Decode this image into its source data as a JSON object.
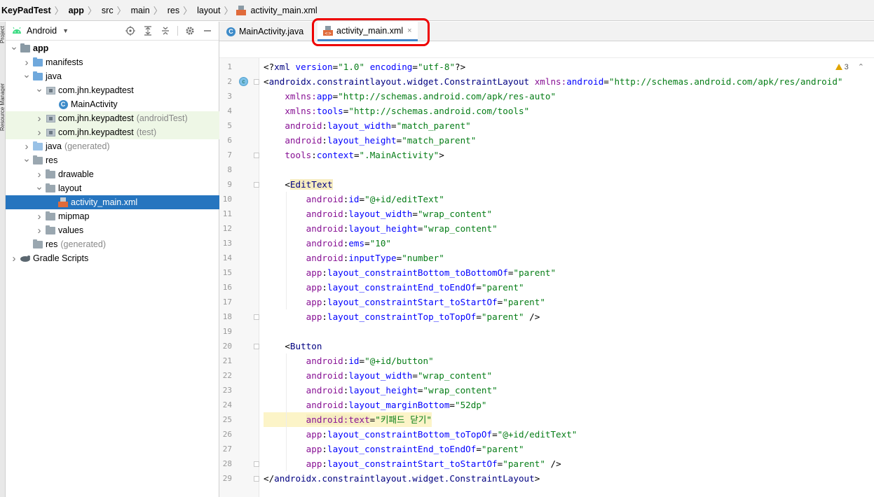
{
  "breadcrumb": [
    "KeyPadTest",
    "app",
    "src",
    "main",
    "res",
    "layout",
    "activity_main.xml"
  ],
  "side_tabs": [
    "Project",
    "Resource Manager"
  ],
  "project_panel": {
    "view_mode": "Android",
    "tool_icons": [
      "target-icon",
      "expand-all-icon",
      "collapse-all-icon",
      "gear-icon",
      "minimize-icon"
    ]
  },
  "tree": [
    {
      "label": "app",
      "hint": "",
      "depth": 0,
      "expanded": true,
      "icon": "module",
      "bold": true
    },
    {
      "label": "manifests",
      "hint": "",
      "depth": 1,
      "expanded": false,
      "icon": "folder-blue"
    },
    {
      "label": "java",
      "hint": "",
      "depth": 1,
      "expanded": true,
      "icon": "folder-blue"
    },
    {
      "label": "com.jhn.keypadtest",
      "hint": "",
      "depth": 2,
      "expanded": true,
      "icon": "package"
    },
    {
      "label": "MainActivity",
      "hint": "",
      "depth": 3,
      "expanded": null,
      "icon": "class"
    },
    {
      "label": "com.jhn.keypadtest",
      "hint": "(androidTest)",
      "depth": 2,
      "expanded": false,
      "icon": "package",
      "test": true
    },
    {
      "label": "com.jhn.keypadtest",
      "hint": "(test)",
      "depth": 2,
      "expanded": false,
      "icon": "package",
      "test": true
    },
    {
      "label": "java",
      "hint": "(generated)",
      "depth": 1,
      "expanded": false,
      "icon": "folder-gen"
    },
    {
      "label": "res",
      "hint": "",
      "depth": 1,
      "expanded": true,
      "icon": "folder"
    },
    {
      "label": "drawable",
      "hint": "",
      "depth": 2,
      "expanded": false,
      "icon": "folder"
    },
    {
      "label": "layout",
      "hint": "",
      "depth": 2,
      "expanded": true,
      "icon": "folder"
    },
    {
      "label": "activity_main.xml",
      "hint": "",
      "depth": 3,
      "expanded": null,
      "icon": "xml",
      "selected": true
    },
    {
      "label": "mipmap",
      "hint": "",
      "depth": 2,
      "expanded": false,
      "icon": "folder"
    },
    {
      "label": "values",
      "hint": "",
      "depth": 2,
      "expanded": false,
      "icon": "folder"
    },
    {
      "label": "res",
      "hint": "(generated)",
      "depth": 1,
      "expanded": null,
      "icon": "folder"
    },
    {
      "label": "Gradle Scripts",
      "hint": "",
      "depth": 0,
      "expanded": false,
      "icon": "gradle"
    }
  ],
  "tabs": [
    {
      "label": "MainActivity.java",
      "icon": "class",
      "active": false
    },
    {
      "label": "activity_main.xml",
      "icon": "xml",
      "active": true,
      "close": "×"
    }
  ],
  "editor": {
    "warnings": "3",
    "lines": [
      [
        [
          "pun",
          "<?"
        ],
        [
          "tag",
          "xml "
        ],
        [
          "at",
          "version"
        ],
        [
          "pun",
          "="
        ],
        [
          "str",
          "\"1.0\""
        ],
        [
          "pun",
          " "
        ],
        [
          "at",
          "encoding"
        ],
        [
          "pun",
          "="
        ],
        [
          "str",
          "\"utf-8\""
        ],
        [
          "pun",
          "?>"
        ]
      ],
      [
        [
          "pun",
          "<"
        ],
        [
          "tag",
          "androidx.constraintlayout.widget.ConstraintLayout"
        ],
        [
          "pun",
          " "
        ],
        [
          "ns",
          "xmlns:"
        ],
        [
          "at",
          "android"
        ],
        [
          "pun",
          "="
        ],
        [
          "str",
          "\"http://schemas.android.com/apk/res/android\""
        ]
      ],
      [
        [
          "pun",
          "    "
        ],
        [
          "ns",
          "xmlns:"
        ],
        [
          "at",
          "app"
        ],
        [
          "pun",
          "="
        ],
        [
          "str",
          "\"http://schemas.android.com/apk/res-auto\""
        ]
      ],
      [
        [
          "pun",
          "    "
        ],
        [
          "ns",
          "xmlns:"
        ],
        [
          "at",
          "tools"
        ],
        [
          "pun",
          "="
        ],
        [
          "str",
          "\"http://schemas.android.com/tools\""
        ]
      ],
      [
        [
          "pun",
          "    "
        ],
        [
          "ns",
          "android"
        ],
        [
          "pun",
          ":"
        ],
        [
          "at",
          "layout_width"
        ],
        [
          "pun",
          "="
        ],
        [
          "str",
          "\"match_parent\""
        ]
      ],
      [
        [
          "pun",
          "    "
        ],
        [
          "ns",
          "android"
        ],
        [
          "pun",
          ":"
        ],
        [
          "at",
          "layout_height"
        ],
        [
          "pun",
          "="
        ],
        [
          "str",
          "\"match_parent\""
        ]
      ],
      [
        [
          "pun",
          "    "
        ],
        [
          "ns",
          "tools"
        ],
        [
          "pun",
          ":"
        ],
        [
          "at",
          "context"
        ],
        [
          "pun",
          "="
        ],
        [
          "str",
          "\".MainActivity\""
        ],
        [
          "pun",
          ">"
        ]
      ],
      [],
      [
        [
          "pun",
          "    <"
        ],
        [
          "tagbg",
          "EditText"
        ]
      ],
      [
        [
          "pun",
          "        "
        ],
        [
          "ns",
          "android"
        ],
        [
          "pun",
          ":"
        ],
        [
          "at",
          "id"
        ],
        [
          "pun",
          "="
        ],
        [
          "str",
          "\"@+id/editText\""
        ]
      ],
      [
        [
          "pun",
          "        "
        ],
        [
          "ns",
          "android"
        ],
        [
          "pun",
          ":"
        ],
        [
          "at",
          "layout_width"
        ],
        [
          "pun",
          "="
        ],
        [
          "str",
          "\"wrap_content\""
        ]
      ],
      [
        [
          "pun",
          "        "
        ],
        [
          "ns",
          "android"
        ],
        [
          "pun",
          ":"
        ],
        [
          "at",
          "layout_height"
        ],
        [
          "pun",
          "="
        ],
        [
          "str",
          "\"wrap_content\""
        ]
      ],
      [
        [
          "pun",
          "        "
        ],
        [
          "ns",
          "android"
        ],
        [
          "pun",
          ":"
        ],
        [
          "at",
          "ems"
        ],
        [
          "pun",
          "="
        ],
        [
          "str",
          "\"10\""
        ]
      ],
      [
        [
          "pun",
          "        "
        ],
        [
          "ns",
          "android"
        ],
        [
          "pun",
          ":"
        ],
        [
          "at",
          "inputType"
        ],
        [
          "pun",
          "="
        ],
        [
          "str",
          "\"number\""
        ]
      ],
      [
        [
          "pun",
          "        "
        ],
        [
          "ns",
          "app"
        ],
        [
          "pun",
          ":"
        ],
        [
          "at",
          "layout_constraintBottom_toBottomOf"
        ],
        [
          "pun",
          "="
        ],
        [
          "str",
          "\"parent\""
        ]
      ],
      [
        [
          "pun",
          "        "
        ],
        [
          "ns",
          "app"
        ],
        [
          "pun",
          ":"
        ],
        [
          "at",
          "layout_constraintEnd_toEndOf"
        ],
        [
          "pun",
          "="
        ],
        [
          "str",
          "\"parent\""
        ]
      ],
      [
        [
          "pun",
          "        "
        ],
        [
          "ns",
          "app"
        ],
        [
          "pun",
          ":"
        ],
        [
          "at",
          "layout_constraintStart_toStartOf"
        ],
        [
          "pun",
          "="
        ],
        [
          "str",
          "\"parent\""
        ]
      ],
      [
        [
          "pun",
          "        "
        ],
        [
          "ns",
          "app"
        ],
        [
          "pun",
          ":"
        ],
        [
          "at",
          "layout_constraintTop_toTopOf"
        ],
        [
          "pun",
          "="
        ],
        [
          "str",
          "\"parent\""
        ],
        [
          "pun",
          " />"
        ]
      ],
      [],
      [
        [
          "pun",
          "    <"
        ],
        [
          "tag",
          "Button"
        ]
      ],
      [
        [
          "pun",
          "        "
        ],
        [
          "ns",
          "android"
        ],
        [
          "pun",
          ":"
        ],
        [
          "at",
          "id"
        ],
        [
          "pun",
          "="
        ],
        [
          "str",
          "\"@+id/button\""
        ]
      ],
      [
        [
          "pun",
          "        "
        ],
        [
          "ns",
          "android"
        ],
        [
          "pun",
          ":"
        ],
        [
          "at",
          "layout_width"
        ],
        [
          "pun",
          "="
        ],
        [
          "str",
          "\"wrap_content\""
        ]
      ],
      [
        [
          "pun",
          "        "
        ],
        [
          "ns",
          "android"
        ],
        [
          "pun",
          ":"
        ],
        [
          "at",
          "layout_height"
        ],
        [
          "pun",
          "="
        ],
        [
          "str",
          "\"wrap_content\""
        ]
      ],
      [
        [
          "pun",
          "        "
        ],
        [
          "ns",
          "android"
        ],
        [
          "pun",
          ":"
        ],
        [
          "at",
          "layout_marginBottom"
        ],
        [
          "pun",
          "="
        ],
        [
          "str",
          "\"52dp\""
        ]
      ],
      [
        [
          "pun",
          "        "
        ],
        [
          "nshl",
          "android:text"
        ],
        [
          "pun",
          "="
        ],
        [
          "str",
          "\"키패드 닫기\""
        ]
      ],
      [
        [
          "pun",
          "        "
        ],
        [
          "ns",
          "app"
        ],
        [
          "pun",
          ":"
        ],
        [
          "at",
          "layout_constraintBottom_toTopOf"
        ],
        [
          "pun",
          "="
        ],
        [
          "str",
          "\"@+id/editText\""
        ]
      ],
      [
        [
          "pun",
          "        "
        ],
        [
          "ns",
          "app"
        ],
        [
          "pun",
          ":"
        ],
        [
          "at",
          "layout_constraintEnd_toEndOf"
        ],
        [
          "pun",
          "="
        ],
        [
          "str",
          "\"parent\""
        ]
      ],
      [
        [
          "pun",
          "        "
        ],
        [
          "ns",
          "app"
        ],
        [
          "pun",
          ":"
        ],
        [
          "at",
          "layout_constraintStart_toStartOf"
        ],
        [
          "pun",
          "="
        ],
        [
          "str",
          "\"parent\""
        ],
        [
          "pun",
          " />"
        ]
      ],
      [
        [
          "pun",
          "</"
        ],
        [
          "tag",
          "androidx.constraintlayout.widget.ConstraintLayout"
        ],
        [
          "pun",
          ">"
        ]
      ]
    ]
  },
  "colors": {
    "selection": "#2675bf",
    "annotation_box": "#e00000",
    "string": "#067d17",
    "tag": "#000080",
    "attribute": "#0000ff",
    "namespace": "#871094"
  }
}
